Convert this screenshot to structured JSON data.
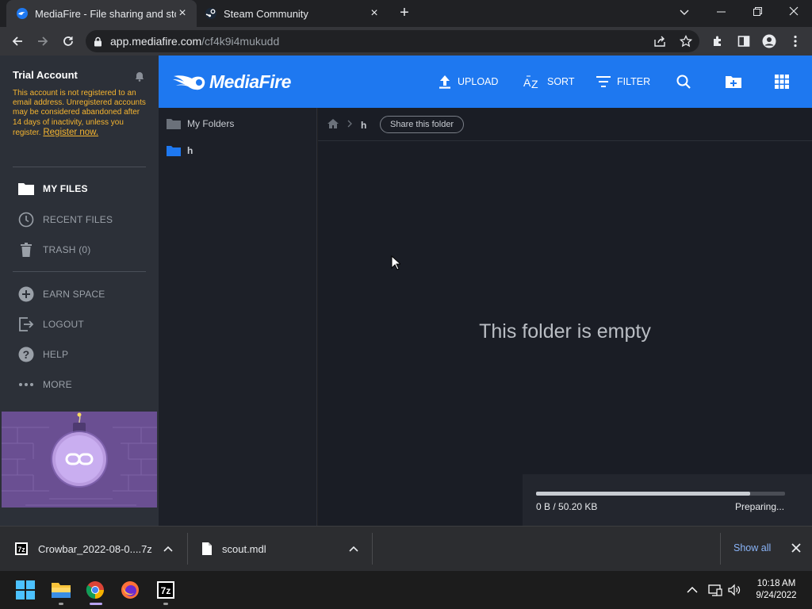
{
  "browser": {
    "tabs": [
      {
        "title": "MediaFire - File sharing and stora",
        "favicon": "mediafire-favicon",
        "active": true
      },
      {
        "title": "Steam Community",
        "favicon": "steam-favicon",
        "active": false
      }
    ],
    "address": {
      "host": "app.mediafire.com",
      "path": "/cf4k9i4mukudd"
    }
  },
  "sidebar": {
    "account_title": "Trial Account",
    "warning": "This account is not registered to an email address. Unregistered accounts may be considered abandoned after 14 days of inactivity, unless you register.",
    "register_link": "Register now.",
    "items": [
      {
        "label": "MY FILES",
        "icon": "folder-icon",
        "active": true
      },
      {
        "label": "RECENT FILES",
        "icon": "clock-icon",
        "active": false
      },
      {
        "label": "TRASH (0)",
        "icon": "trash-icon",
        "active": false
      },
      {
        "label": "EARN SPACE",
        "icon": "plus-circle-icon",
        "active": false
      },
      {
        "label": "LOGOUT",
        "icon": "logout-icon",
        "active": false
      },
      {
        "label": "HELP",
        "icon": "help-icon",
        "active": false
      },
      {
        "label": "MORE",
        "icon": "more-icon",
        "active": false
      }
    ]
  },
  "header": {
    "logo_text": "MediaFire",
    "upload": "UPLOAD",
    "sort": "SORT",
    "filter": "FILTER",
    "brand_color": "#1e78f0"
  },
  "tree": {
    "root": "My Folders",
    "folders": [
      "h"
    ]
  },
  "main": {
    "breadcrumb_current": "h",
    "share_label": "Share this folder",
    "empty_message": "This folder is empty",
    "upload_progress": {
      "text": "0 B / 50.20 KB",
      "status": "Preparing...",
      "fraction": 0.86
    }
  },
  "downloads": {
    "items": [
      {
        "name": "Crowbar_2022-08-0....7z",
        "icon": "7z-file-icon"
      },
      {
        "name": "scout.mdl",
        "icon": "file-icon"
      }
    ],
    "show_all": "Show all"
  },
  "taskbar": {
    "time": "10:18 AM",
    "date": "9/24/2022"
  }
}
